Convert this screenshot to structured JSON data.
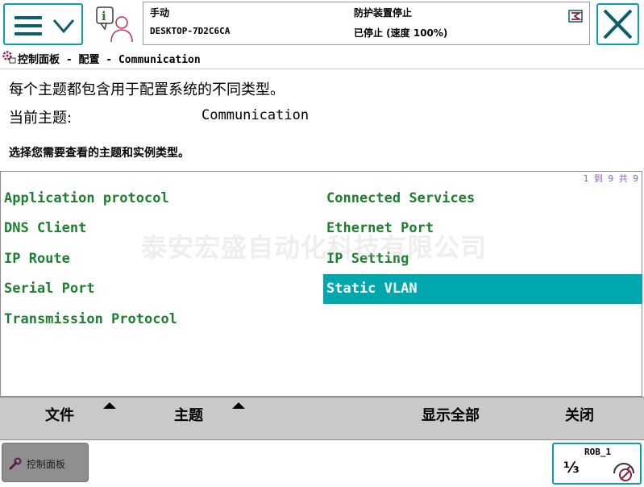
{
  "header": {
    "mode": "手动",
    "system_name": "DESKTOP-7D2C6CA",
    "safety_status": "防护装置停止",
    "run_status": "已停止 (速度 100%)"
  },
  "breadcrumb": {
    "text": "控制面板 - 配置 - Communication"
  },
  "info": {
    "description": "每个主题都包含用于配置系统的不同类型。",
    "current_topic_label": "当前主题:",
    "current_topic_value": "Communication",
    "instruction": "选择您需要查看的主题和实例类型。"
  },
  "list": {
    "pager": "1 到 9 共 9",
    "items": [
      {
        "label": "Application protocol",
        "selected": false
      },
      {
        "label": "Connected Services",
        "selected": false
      },
      {
        "label": "DNS Client",
        "selected": false
      },
      {
        "label": "Ethernet Port",
        "selected": false
      },
      {
        "label": "IP Route",
        "selected": false
      },
      {
        "label": "IP Setting",
        "selected": false
      },
      {
        "label": "Serial Port",
        "selected": false
      },
      {
        "label": "Static VLAN",
        "selected": true
      },
      {
        "label": "Transmission Protocol",
        "selected": false
      }
    ]
  },
  "watermark": "泰安宏盛自动化科技有限公司",
  "toolbar": {
    "file": "文件",
    "topic": "主题",
    "show_all": "显示全部",
    "close": "关闭"
  },
  "taskbar": {
    "control_panel": "控制面板",
    "robot_name": "ROB_1",
    "fraction": "⅓"
  },
  "colors": {
    "accent": "#0aa0ad",
    "item_text": "#1e7f2f",
    "selected_bg": "#00a7ad",
    "toolbar_bg": "#c9c9c9",
    "pager": "#8a5cc8"
  }
}
